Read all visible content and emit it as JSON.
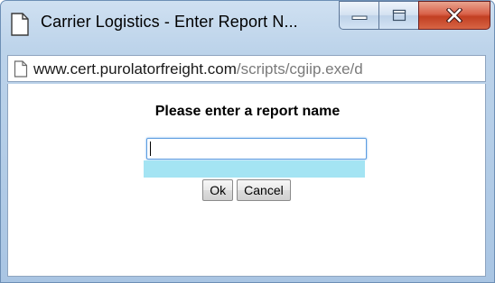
{
  "window": {
    "title": "Carrier Logistics - Enter Report N...",
    "controls": {
      "minimize": "minimize-icon",
      "maximize": "maximize-icon",
      "close": "close-icon"
    }
  },
  "address_bar": {
    "url_host": "www.cert.purolatorfreight.com",
    "url_path": "/scripts/cgiip.exe/d"
  },
  "dialog": {
    "prompt": "Please enter a report name",
    "report_name_value": "",
    "ok_label": "Ok",
    "cancel_label": "Cancel"
  },
  "colors": {
    "titlebar": "#bcd3ea",
    "close_button": "#c23f22",
    "input_focus_border": "#5d9de0",
    "highlight": "#a4e4f3"
  }
}
